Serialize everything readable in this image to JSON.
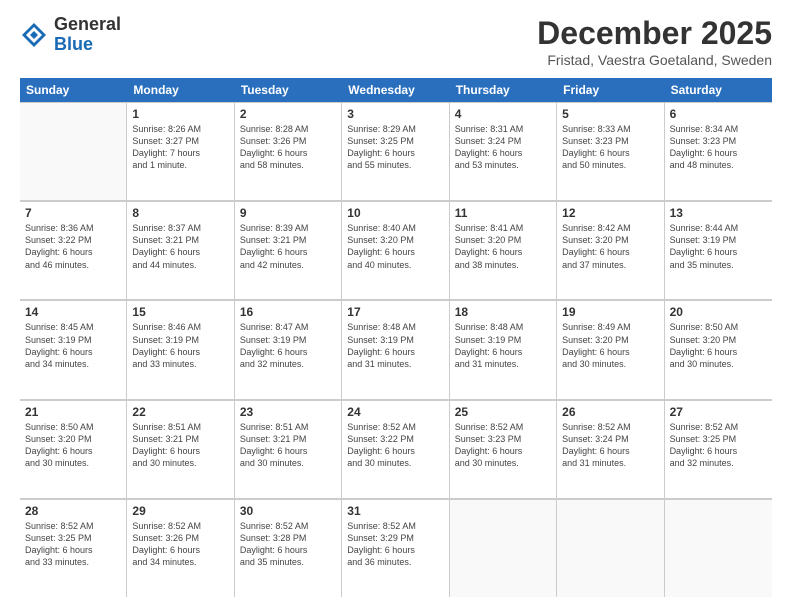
{
  "logo": {
    "general": "General",
    "blue": "Blue"
  },
  "title": "December 2025",
  "subtitle": "Fristad, Vaestra Goetaland, Sweden",
  "calendar": {
    "headers": [
      "Sunday",
      "Monday",
      "Tuesday",
      "Wednesday",
      "Thursday",
      "Friday",
      "Saturday"
    ],
    "weeks": [
      [
        {
          "day": "",
          "info": ""
        },
        {
          "day": "1",
          "info": "Sunrise: 8:26 AM\nSunset: 3:27 PM\nDaylight: 7 hours\nand 1 minute."
        },
        {
          "day": "2",
          "info": "Sunrise: 8:28 AM\nSunset: 3:26 PM\nDaylight: 6 hours\nand 58 minutes."
        },
        {
          "day": "3",
          "info": "Sunrise: 8:29 AM\nSunset: 3:25 PM\nDaylight: 6 hours\nand 55 minutes."
        },
        {
          "day": "4",
          "info": "Sunrise: 8:31 AM\nSunset: 3:24 PM\nDaylight: 6 hours\nand 53 minutes."
        },
        {
          "day": "5",
          "info": "Sunrise: 8:33 AM\nSunset: 3:23 PM\nDaylight: 6 hours\nand 50 minutes."
        },
        {
          "day": "6",
          "info": "Sunrise: 8:34 AM\nSunset: 3:23 PM\nDaylight: 6 hours\nand 48 minutes."
        }
      ],
      [
        {
          "day": "7",
          "info": "Sunrise: 8:36 AM\nSunset: 3:22 PM\nDaylight: 6 hours\nand 46 minutes."
        },
        {
          "day": "8",
          "info": "Sunrise: 8:37 AM\nSunset: 3:21 PM\nDaylight: 6 hours\nand 44 minutes."
        },
        {
          "day": "9",
          "info": "Sunrise: 8:39 AM\nSunset: 3:21 PM\nDaylight: 6 hours\nand 42 minutes."
        },
        {
          "day": "10",
          "info": "Sunrise: 8:40 AM\nSunset: 3:20 PM\nDaylight: 6 hours\nand 40 minutes."
        },
        {
          "day": "11",
          "info": "Sunrise: 8:41 AM\nSunset: 3:20 PM\nDaylight: 6 hours\nand 38 minutes."
        },
        {
          "day": "12",
          "info": "Sunrise: 8:42 AM\nSunset: 3:20 PM\nDaylight: 6 hours\nand 37 minutes."
        },
        {
          "day": "13",
          "info": "Sunrise: 8:44 AM\nSunset: 3:19 PM\nDaylight: 6 hours\nand 35 minutes."
        }
      ],
      [
        {
          "day": "14",
          "info": "Sunrise: 8:45 AM\nSunset: 3:19 PM\nDaylight: 6 hours\nand 34 minutes."
        },
        {
          "day": "15",
          "info": "Sunrise: 8:46 AM\nSunset: 3:19 PM\nDaylight: 6 hours\nand 33 minutes."
        },
        {
          "day": "16",
          "info": "Sunrise: 8:47 AM\nSunset: 3:19 PM\nDaylight: 6 hours\nand 32 minutes."
        },
        {
          "day": "17",
          "info": "Sunrise: 8:48 AM\nSunset: 3:19 PM\nDaylight: 6 hours\nand 31 minutes."
        },
        {
          "day": "18",
          "info": "Sunrise: 8:48 AM\nSunset: 3:19 PM\nDaylight: 6 hours\nand 31 minutes."
        },
        {
          "day": "19",
          "info": "Sunrise: 8:49 AM\nSunset: 3:20 PM\nDaylight: 6 hours\nand 30 minutes."
        },
        {
          "day": "20",
          "info": "Sunrise: 8:50 AM\nSunset: 3:20 PM\nDaylight: 6 hours\nand 30 minutes."
        }
      ],
      [
        {
          "day": "21",
          "info": "Sunrise: 8:50 AM\nSunset: 3:20 PM\nDaylight: 6 hours\nand 30 minutes."
        },
        {
          "day": "22",
          "info": "Sunrise: 8:51 AM\nSunset: 3:21 PM\nDaylight: 6 hours\nand 30 minutes."
        },
        {
          "day": "23",
          "info": "Sunrise: 8:51 AM\nSunset: 3:21 PM\nDaylight: 6 hours\nand 30 minutes."
        },
        {
          "day": "24",
          "info": "Sunrise: 8:52 AM\nSunset: 3:22 PM\nDaylight: 6 hours\nand 30 minutes."
        },
        {
          "day": "25",
          "info": "Sunrise: 8:52 AM\nSunset: 3:23 PM\nDaylight: 6 hours\nand 30 minutes."
        },
        {
          "day": "26",
          "info": "Sunrise: 8:52 AM\nSunset: 3:24 PM\nDaylight: 6 hours\nand 31 minutes."
        },
        {
          "day": "27",
          "info": "Sunrise: 8:52 AM\nSunset: 3:25 PM\nDaylight: 6 hours\nand 32 minutes."
        }
      ],
      [
        {
          "day": "28",
          "info": "Sunrise: 8:52 AM\nSunset: 3:25 PM\nDaylight: 6 hours\nand 33 minutes."
        },
        {
          "day": "29",
          "info": "Sunrise: 8:52 AM\nSunset: 3:26 PM\nDaylight: 6 hours\nand 34 minutes."
        },
        {
          "day": "30",
          "info": "Sunrise: 8:52 AM\nSunset: 3:28 PM\nDaylight: 6 hours\nand 35 minutes."
        },
        {
          "day": "31",
          "info": "Sunrise: 8:52 AM\nSunset: 3:29 PM\nDaylight: 6 hours\nand 36 minutes."
        },
        {
          "day": "",
          "info": ""
        },
        {
          "day": "",
          "info": ""
        },
        {
          "day": "",
          "info": ""
        }
      ]
    ]
  }
}
